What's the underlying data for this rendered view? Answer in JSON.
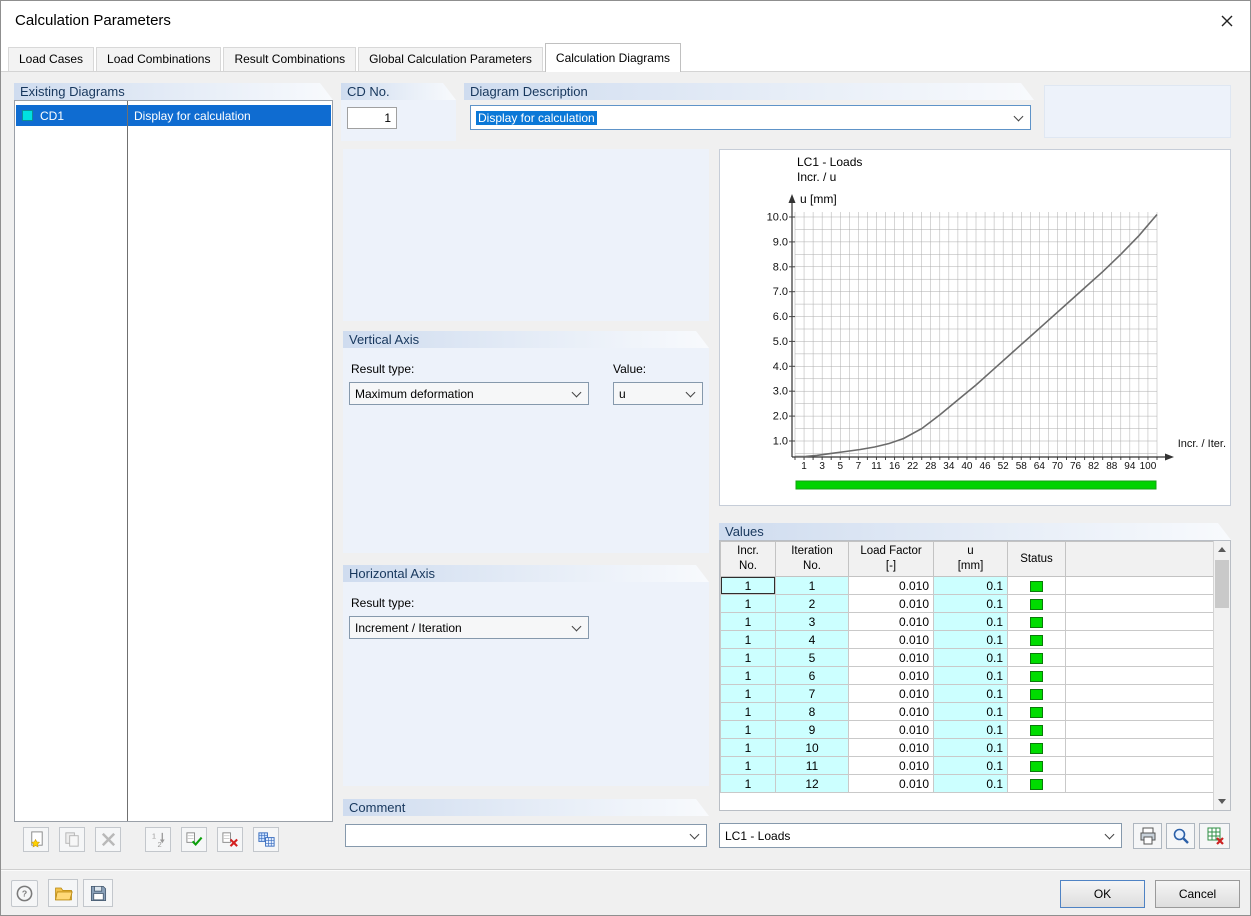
{
  "window": {
    "title": "Calculation Parameters"
  },
  "tabs": [
    {
      "label": "Load Cases"
    },
    {
      "label": "Load Combinations"
    },
    {
      "label": "Result Combinations"
    },
    {
      "label": "Global Calculation Parameters"
    },
    {
      "label": "Calculation Diagrams"
    }
  ],
  "existing_diagrams": {
    "header": "Existing Diagrams",
    "items": [
      {
        "id": "CD1",
        "description": "Display for calculation",
        "selected": true
      }
    ],
    "toolbar_icons": [
      "new-diagram",
      "copy-diagram",
      "delete-diagram",
      "renumber-diagrams",
      "set-check-marks",
      "delete-check-marks",
      "select-diagrams"
    ]
  },
  "cd_no": {
    "header": "CD No.",
    "value": "1"
  },
  "diagram_description": {
    "header": "Diagram Description",
    "value": "Display for calculation"
  },
  "vertical_axis": {
    "header": "Vertical Axis",
    "result_type_label": "Result type:",
    "result_type": "Maximum deformation",
    "value_label": "Value:",
    "value": "u"
  },
  "horizontal_axis": {
    "header": "Horizontal Axis",
    "result_type_label": "Result type:",
    "result_type": "Increment / Iteration"
  },
  "comment": {
    "header": "Comment",
    "value": ""
  },
  "chart_data": {
    "type": "line",
    "title": "LC1 - Loads",
    "subtitle": "Incr. / u",
    "ylabel": "u [mm]",
    "xlabel": "Incr. / Iter.",
    "x_ticks": [
      "1",
      "3",
      "5",
      "7",
      "11",
      "16",
      "22",
      "28",
      "34",
      "40",
      "46",
      "52",
      "58",
      "64",
      "70",
      "76",
      "82",
      "88",
      "94",
      "100"
    ],
    "y_ticks": [
      1,
      2,
      3,
      4,
      5,
      6,
      7,
      8,
      9,
      10
    ],
    "ylim": [
      0.3,
      10.5
    ],
    "grid": true,
    "legend": "none",
    "series": [
      {
        "name": "u",
        "points": [
          [
            0,
            0.32
          ],
          [
            0.03,
            0.38
          ],
          [
            0.06,
            0.42
          ],
          [
            0.1,
            0.5
          ],
          [
            0.14,
            0.58
          ],
          [
            0.18,
            0.66
          ],
          [
            0.22,
            0.76
          ],
          [
            0.26,
            0.9
          ],
          [
            0.3,
            1.1
          ],
          [
            0.35,
            1.5
          ],
          [
            0.4,
            2.05
          ],
          [
            0.45,
            2.65
          ],
          [
            0.5,
            3.25
          ],
          [
            0.55,
            3.9
          ],
          [
            0.6,
            4.55
          ],
          [
            0.65,
            5.2
          ],
          [
            0.7,
            5.85
          ],
          [
            0.75,
            6.5
          ],
          [
            0.8,
            7.15
          ],
          [
            0.85,
            7.8
          ],
          [
            0.9,
            8.5
          ],
          [
            0.95,
            9.25
          ],
          [
            1,
            10.1
          ]
        ]
      }
    ],
    "progress_bar": {
      "color": "#00d300",
      "full": true
    }
  },
  "values_table": {
    "header": "Values",
    "columns": [
      {
        "line1": "Incr.",
        "line2": "No."
      },
      {
        "line1": "Iteration",
        "line2": "No."
      },
      {
        "line1": "Load Factor",
        "line2": "[-]"
      },
      {
        "line1": "u",
        "line2": "[mm]"
      },
      {
        "line1": "Status",
        "line2": ""
      },
      {
        "line1": "",
        "line2": ""
      }
    ],
    "rows": [
      {
        "incr": "1",
        "iter": "1",
        "load_factor": "0.010",
        "u": "0.1",
        "status": "green"
      },
      {
        "incr": "1",
        "iter": "2",
        "load_factor": "0.010",
        "u": "0.1",
        "status": "green"
      },
      {
        "incr": "1",
        "iter": "3",
        "load_factor": "0.010",
        "u": "0.1",
        "status": "green"
      },
      {
        "incr": "1",
        "iter": "4",
        "load_factor": "0.010",
        "u": "0.1",
        "status": "green"
      },
      {
        "incr": "1",
        "iter": "5",
        "load_factor": "0.010",
        "u": "0.1",
        "status": "green"
      },
      {
        "incr": "1",
        "iter": "6",
        "load_factor": "0.010",
        "u": "0.1",
        "status": "green"
      },
      {
        "incr": "1",
        "iter": "7",
        "load_factor": "0.010",
        "u": "0.1",
        "status": "green"
      },
      {
        "incr": "1",
        "iter": "8",
        "load_factor": "0.010",
        "u": "0.1",
        "status": "green"
      },
      {
        "incr": "1",
        "iter": "9",
        "load_factor": "0.010",
        "u": "0.1",
        "status": "green"
      },
      {
        "incr": "1",
        "iter": "10",
        "load_factor": "0.010",
        "u": "0.1",
        "status": "green"
      },
      {
        "incr": "1",
        "iter": "11",
        "load_factor": "0.010",
        "u": "0.1",
        "status": "green"
      },
      {
        "incr": "1",
        "iter": "12",
        "load_factor": "0.010",
        "u": "0.1",
        "status": "green"
      }
    ],
    "selector_value": "LC1 - Loads",
    "footer_icons": [
      "print",
      "zoom",
      "export-excel"
    ]
  },
  "footer": {
    "ok_label": "OK",
    "cancel_label": "Cancel",
    "icons": [
      "help",
      "open-file",
      "save"
    ]
  },
  "colors": {
    "selection_blue": "#0f6cd1",
    "highlight_blue": "#0b78d7",
    "table_cyan": "#ccffff",
    "status_green": "#00dc00",
    "progress_green": "#00d300",
    "group_header_text": "#17375d",
    "group_header_bg": "#cfdcef",
    "panel_blue": "#edf2fa"
  }
}
